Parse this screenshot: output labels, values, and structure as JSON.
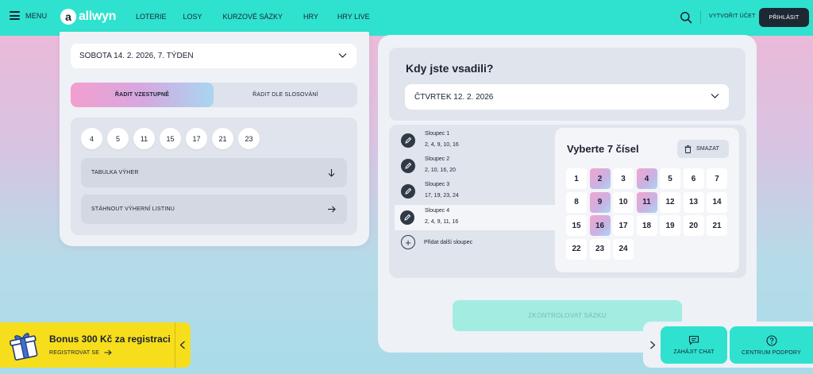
{
  "header": {
    "menu_label": "MENU",
    "logo_mark": "a",
    "logo_text": "allwyn",
    "nav": [
      "LOTERIE",
      "LOSY",
      "KURZOVÉ SÁZKY",
      "HRY",
      "HRY LIVE"
    ],
    "create_account": "VYTVOŘIT ÚČET",
    "login": "PŘIHLÁSIT"
  },
  "draw": {
    "date_select": "SOBOTA 14. 2. 2026, 7. TÝDEN",
    "sort_ascending": "ŘADIT VZESTUPNĚ",
    "sort_by_draw": "ŘADIT DLE SLOSOVÁNÍ",
    "sort_active": "ascending",
    "numbers": [
      "4",
      "5",
      "11",
      "15",
      "17",
      "21",
      "23"
    ],
    "table_label": "TABULKA VÝHER",
    "download_label": "STÁHNOUT VÝHERNÍ LISTINU"
  },
  "check": {
    "title": "Kdy jste vsadili?",
    "bet_date": "ČTVRTEK 12. 2. 2026",
    "columns": [
      {
        "name": "Sloupec 1",
        "numbers": "2, 4, 9, 10, 16"
      },
      {
        "name": "Sloupec 2",
        "numbers": "2, 10, 16, 20"
      },
      {
        "name": "Sloupec 3",
        "numbers": "17, 19, 23, 24"
      },
      {
        "name": "Sloupec 4",
        "numbers": "2, 4, 9, 11, 16"
      }
    ],
    "active_column": 4,
    "add_column": "Přidat další sloupec",
    "pick_title": "Vyberte 7 čísel",
    "clear": "SMAZAT",
    "grid_numbers": [
      1,
      2,
      3,
      4,
      5,
      6,
      7,
      8,
      9,
      10,
      11,
      12,
      13,
      14,
      15,
      16,
      17,
      18,
      19,
      20,
      21,
      22,
      23,
      24
    ],
    "selected": [
      2,
      4,
      9,
      11,
      16
    ],
    "submit": "ZKONTROLOVAT SÁZKU"
  },
  "bonus": {
    "title": "Bonus 300 Kč za registraci",
    "register": "REGISTROVAT SE"
  },
  "support": {
    "chat": "ZAHÁJIT CHAT",
    "center": "CENTRUM PODPORY"
  },
  "colors": {
    "topbar": "#2ee2cf",
    "dark": "#1c2833",
    "bonus": "#f6de1c",
    "submit_disabled": "#a3ece2"
  },
  "icons": {
    "menu": "hamburger-icon",
    "search": "search-icon",
    "dropdown": "chevron-down-icon",
    "table": "arrow-down-icon",
    "download": "arrow-right-icon",
    "edit": "pencil-icon",
    "add": "plus-icon",
    "clear": "trash-icon",
    "gift": "gift-icon",
    "chat": "chat-icon",
    "support": "question-icon"
  }
}
